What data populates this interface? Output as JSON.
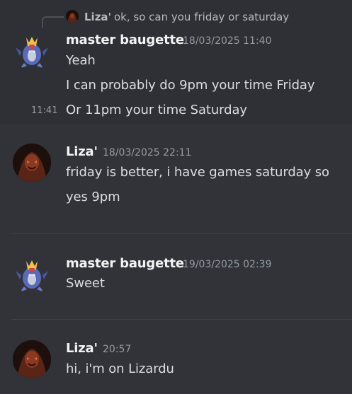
{
  "reply": {
    "author": "Liza'",
    "text": "ok, so can you friday or saturday"
  },
  "groups": [
    {
      "author": "master baugette",
      "timestamp": "18/03/2025 11:40",
      "avatar_icon": "robot-dragon-avatar",
      "messages": [
        {
          "text": "Yeah"
        },
        {
          "text": "I can probably do 9pm your time Friday"
        },
        {
          "text": "Or 11pm your time Saturday",
          "side_time": "11:41"
        }
      ]
    },
    {
      "author": "Liza'",
      "timestamp": "18/03/2025 22:11",
      "avatar_icon": "dark-creature-avatar",
      "messages": [
        {
          "text": "friday is better, i have games saturday so"
        },
        {
          "text": "yes 9pm"
        }
      ]
    },
    {
      "author": "master baugette",
      "timestamp": "19/03/2025 02:39",
      "avatar_icon": "robot-dragon-avatar",
      "messages": [
        {
          "text": "Sweet"
        }
      ]
    },
    {
      "author": "Liza'",
      "timestamp": "20:57",
      "avatar_icon": "dark-creature-avatar",
      "messages": [
        {
          "text": "hi, i'm on Lizardu"
        }
      ]
    }
  ],
  "colors": {
    "background": "#313338",
    "author": "#f2f3f5",
    "message_text": "#dbdee1",
    "muted": "#949ba4",
    "divider": "#3f4147"
  }
}
